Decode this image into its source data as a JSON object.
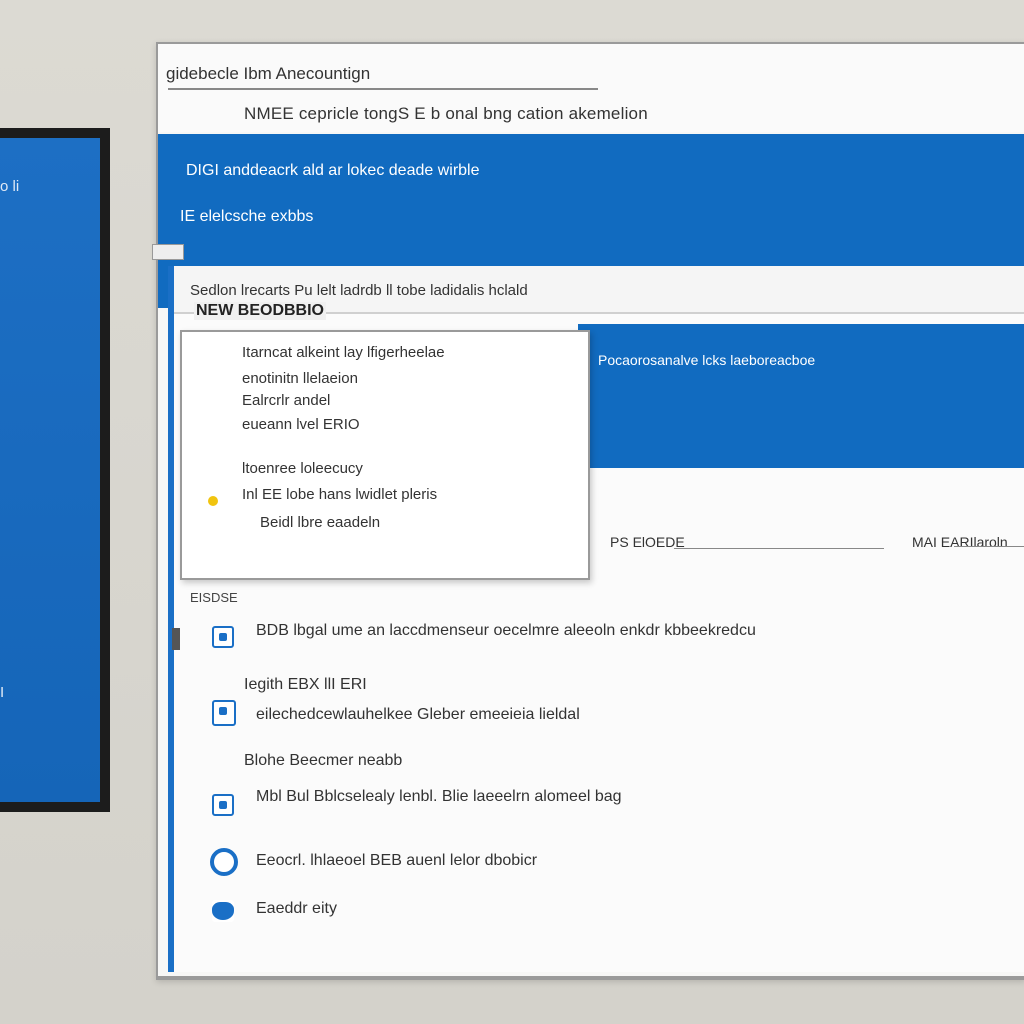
{
  "background_window": {
    "text_top": "o\nli",
    "text_bottom": "I"
  },
  "window": {
    "title": "gidebecle Ibm Anecountign",
    "subtitle": "NMEE cepricle tongS E b onal bng cation akemelion",
    "header_line1": "DIGI anddeacrk ald ar lokec deade wirble",
    "header_line2": "IE elelcsche exbbs",
    "inner_title": "Sedlon lrecarts Pu lelt ladrdb ll tobe ladidalis hclald",
    "inner_label": "NEW BEODBBIO",
    "inner_blue_text": "Pocaorosanalve lcks laeboreacboe",
    "field_label_left": "PS ElOEDE",
    "field_label_right": "MAI EARIlaroln"
  },
  "popup": {
    "lines": [
      "Itarncat alkeint lay lfigerheelae",
      "enotinitn llelaeion",
      "Ealrcrlr andel",
      "eueann lvel ERIO",
      "ltoenree loleecucy",
      "Inl EE lobe hans lwidlet pleris",
      "Beidl lbre eaadeln"
    ]
  },
  "options": {
    "section_label": "EISDSE",
    "items": [
      {
        "icon": "checkbox-icon",
        "text": "BDB lbgal ume an laccdmenseur oecelmre aleeoln enkdr kbbeekredcu"
      },
      {
        "icon": "",
        "text": "Iegith EBX llI ERI"
      },
      {
        "icon": "window-icon",
        "text": "eilechedcewlauhelkee Gleber emeeieia lieldal"
      },
      {
        "icon": "",
        "text": "Blohe Beecmer neabb"
      },
      {
        "icon": "checkbox-icon",
        "text": "Mbl Bul Bblcselealy lenbl. Blie laeeelrn alomeel bag"
      },
      {
        "icon": "radio-icon",
        "text": "Eeocrl. lhlaeoel BEB auenl lelor dbobicr"
      },
      {
        "icon": "puzzle-icon",
        "text": "Eaeddr eity"
      }
    ]
  },
  "colors": {
    "accent": "#116bc0",
    "background": "#d9d7d0",
    "window": "#f7f7f6"
  }
}
